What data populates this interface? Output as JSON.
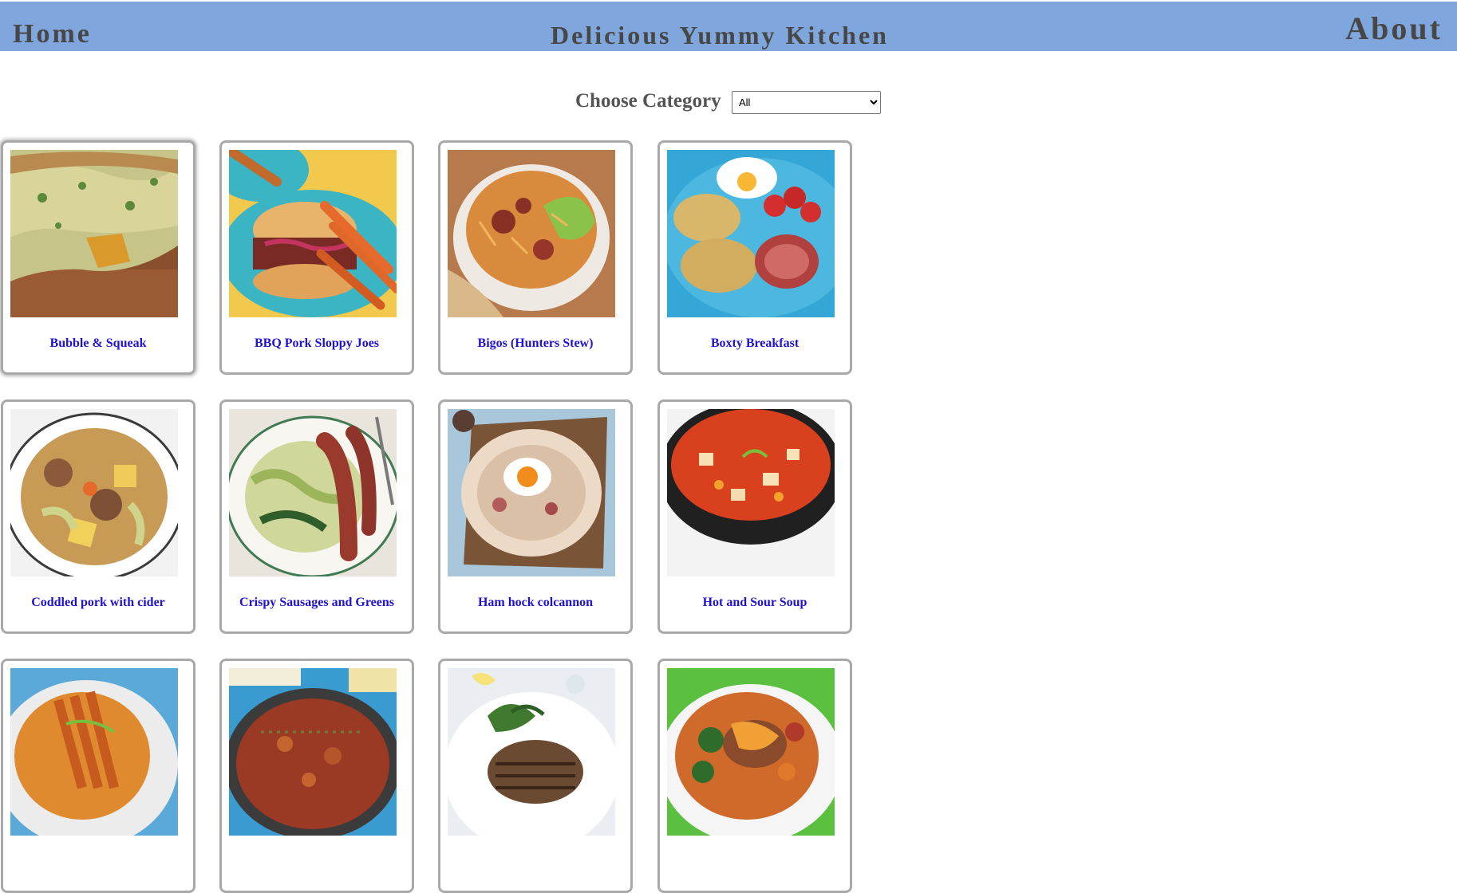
{
  "header": {
    "home_label": "Home",
    "title": "Delicious Yummy Kitchen",
    "about_label": "About",
    "background_color": "#7fa6dd"
  },
  "filter": {
    "label": "Choose Category",
    "selected": "All"
  },
  "recipes": [
    {
      "name": "Bubble & Squeak",
      "image": "bubble-and-squeak-photo"
    },
    {
      "name": "BBQ Pork Sloppy Joes",
      "image": "bbq-pork-sloppy-joes-photo"
    },
    {
      "name": "Bigos (Hunters Stew)",
      "image": "bigos-hunters-stew-photo"
    },
    {
      "name": "Boxty Breakfast",
      "image": "boxty-breakfast-photo"
    },
    {
      "name": "Coddled pork with cider",
      "image": "coddled-pork-with-cider-photo"
    },
    {
      "name": "Crispy Sausages and Greens",
      "image": "crispy-sausages-and-greens-photo"
    },
    {
      "name": "Ham hock colcannon",
      "image": "ham-hock-colcannon-photo"
    },
    {
      "name": "Hot and Sour Soup",
      "image": "hot-and-sour-soup-photo"
    },
    {
      "name": "",
      "image": "recipe-photo-9"
    },
    {
      "name": "",
      "image": "recipe-photo-10"
    },
    {
      "name": "",
      "image": "recipe-photo-11"
    },
    {
      "name": "",
      "image": "recipe-photo-12"
    }
  ],
  "colors": {
    "link": "#1f11d6",
    "card_border": "#a9a9a9",
    "heading_text": "#474747"
  }
}
